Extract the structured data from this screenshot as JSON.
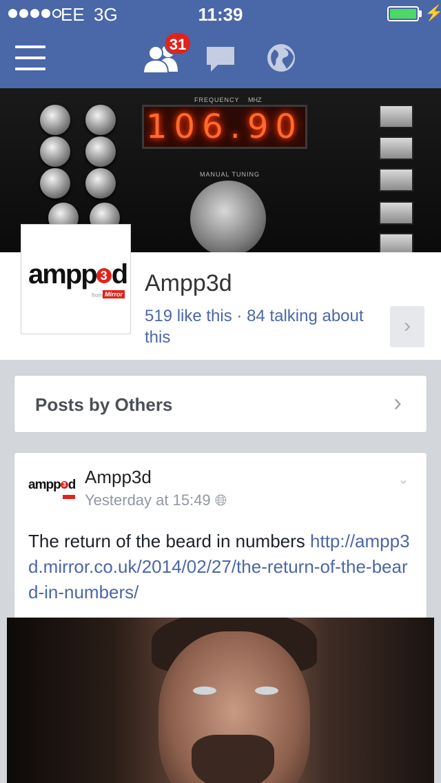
{
  "status_bar": {
    "carrier": "EE",
    "network": "3G",
    "time": "11:39",
    "signal_bars": 4,
    "signal_max": 5,
    "battery_level": 1.0,
    "charging_icon": "lightning-icon"
  },
  "nav": {
    "menu_icon": "hamburger-icon",
    "friends_icon": "friend-requests-icon",
    "friend_requests_count": "31",
    "messages_icon": "messages-icon",
    "notifications_icon": "globe-icon"
  },
  "cover": {
    "frequency_label": "FREQUENCY",
    "mhz_label": "MHZ",
    "display_value": "106.90",
    "manual_tuning_label": "MANUAL TUNING"
  },
  "page": {
    "name": "Ampp3d",
    "stats": "519 like this · 84 talking about this",
    "logo": {
      "prefix": "ampp",
      "three": "3",
      "suffix": "d",
      "sub": "from",
      "mirror": "Mirror"
    }
  },
  "posts_by_others": {
    "label": "Posts by Others"
  },
  "post": {
    "author": "Ampp3d",
    "time": "Yesterday at 15:49",
    "text": "The return of the beard in numbers ",
    "link": "http://ampp3d.mirror.co.uk/2014/02/27/the-return-of-the-beard-in-numbers/"
  },
  "colors": {
    "brand_blue": "#4a67a8",
    "badge_red": "#e0231d",
    "link_blue": "#4a67a8",
    "battery_green": "#4cd964"
  }
}
